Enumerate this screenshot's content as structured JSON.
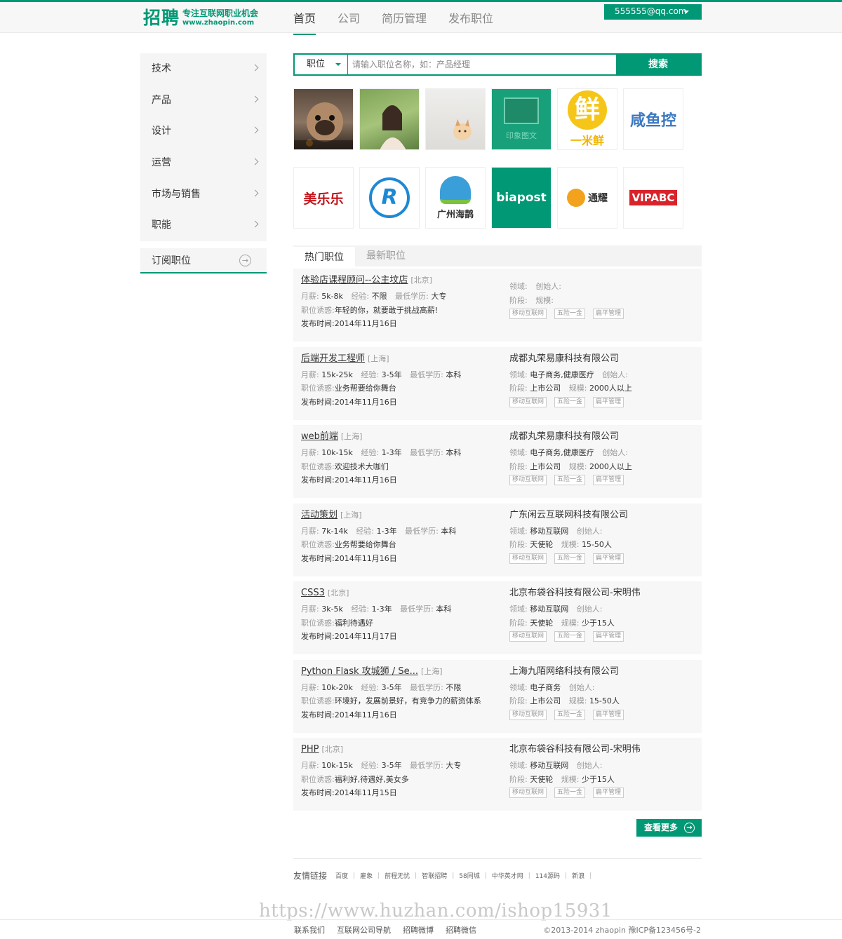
{
  "header": {
    "logo_main": "招聘",
    "logo_slogan": "专注互联网职业机会",
    "logo_url": "www.zhaopin.com",
    "nav": [
      "首页",
      "公司",
      "简历管理",
      "发布职位"
    ],
    "user_email": "555555@qq.com"
  },
  "sidebar": {
    "categories": [
      "技术",
      "产品",
      "设计",
      "运营",
      "市场与销售",
      "职能"
    ],
    "subscribe": "订阅职位"
  },
  "search": {
    "type": "职位",
    "placeholder": "请输入职位名称，如：产品经理",
    "button": "搜索"
  },
  "logos": {
    "row2": [
      "美乐乐",
      "R",
      "广州海鹊",
      "biapost",
      "通耀",
      "VIPABC"
    ],
    "row1_texts": [
      "印象图文",
      "一米鲜",
      "咸鱼控"
    ]
  },
  "tabs": [
    "热门职位",
    "最新职位"
  ],
  "labels": {
    "salary": "月薪:",
    "experience": "经验:",
    "education": "最低学历:",
    "perk": "职位诱惑:",
    "domain": "领域:",
    "founder": "创始人:",
    "stage": "阶段:",
    "scale": "规模:",
    "tags": [
      "移动互联网",
      "五险一金",
      "扁平管理"
    ]
  },
  "jobs": [
    {
      "title": "体验店课程顾问--公主坟店",
      "city": "[北京]",
      "salary": "5k-8k",
      "experience": "不限",
      "education": "大专",
      "perk": "年轻的你，就要敢于挑战高薪!",
      "date": "发布时间:2014年11月16日",
      "company": "",
      "domain": "",
      "stage": "",
      "scale": ""
    },
    {
      "title": "后端开发工程师",
      "city": "[上海]",
      "salary": "15k-25k",
      "experience": "3-5年",
      "education": "本科",
      "perk": "业务帮要给你舞台",
      "date": "发布时间:2014年11月16日",
      "company": "成都丸荣易康科技有限公司",
      "domain": "电子商务,健康医疗",
      "stage": "上市公司",
      "scale": "2000人以上"
    },
    {
      "title": "web前端",
      "city": "[上海]",
      "salary": "10k-15k",
      "experience": "1-3年",
      "education": "本科",
      "perk": "欢迎技术大咖们",
      "date": "发布时间:2014年11月16日",
      "company": "成都丸荣易康科技有限公司",
      "domain": "电子商务,健康医疗",
      "stage": "上市公司",
      "scale": "2000人以上"
    },
    {
      "title": "活动策划",
      "city": "[上海]",
      "salary": "7k-14k",
      "experience": "1-3年",
      "education": "本科",
      "perk": "业务帮要给你舞台",
      "date": "发布时间:2014年11月16日",
      "company": "广东闲云互联网科技有限公司",
      "domain": "移动互联网",
      "stage": "天使轮",
      "scale": "15-50人"
    },
    {
      "title": "CSS3",
      "city": "[北京]",
      "salary": "3k-5k",
      "experience": "1-3年",
      "education": "本科",
      "perk": "福利待遇好",
      "date": "发布时间:2014年11月17日",
      "company": "北京布袋谷科技有限公司-宋明伟",
      "domain": "移动互联网",
      "stage": "天使轮",
      "scale": "少于15人"
    },
    {
      "title": "Python Flask 攻城狮 / Se...",
      "city": "[上海]",
      "salary": "10k-20k",
      "experience": "3-5年",
      "education": "不限",
      "perk": "环境好，发展前景好，有竞争力的薪资体系",
      "date": "发布时间:2014年11月16日",
      "company": "上海九陌网络科技有限公司",
      "domain": "电子商务",
      "stage": "上市公司",
      "scale": "15-50人"
    },
    {
      "title": "PHP",
      "city": "[北京]",
      "salary": "10k-15k",
      "experience": "3-5年",
      "education": "大专",
      "perk": "福利好,待遇好,美女多",
      "date": "发布时间:2014年11月15日",
      "company": "北京布袋谷科技有限公司-宋明伟",
      "domain": "移动互联网",
      "stage": "天使轮",
      "scale": "少于15人"
    }
  ],
  "more_button": "查看更多",
  "friend_links": {
    "title": "友情链接",
    "links": [
      "百度",
      "雇象",
      "前程无忧",
      "智联招聘",
      "58同城",
      "中华英才网",
      "114源码",
      "新浪"
    ]
  },
  "watermark": "https://www.huzhan.com/ishop15931",
  "footer": {
    "links": [
      "联系我们",
      "互联网公司导航",
      "招聘微博",
      "招聘微信"
    ],
    "copyright": "©2013-2014 zhaopin    豫ICP备123456号-2"
  },
  "colors": {
    "brand": "#019875"
  }
}
